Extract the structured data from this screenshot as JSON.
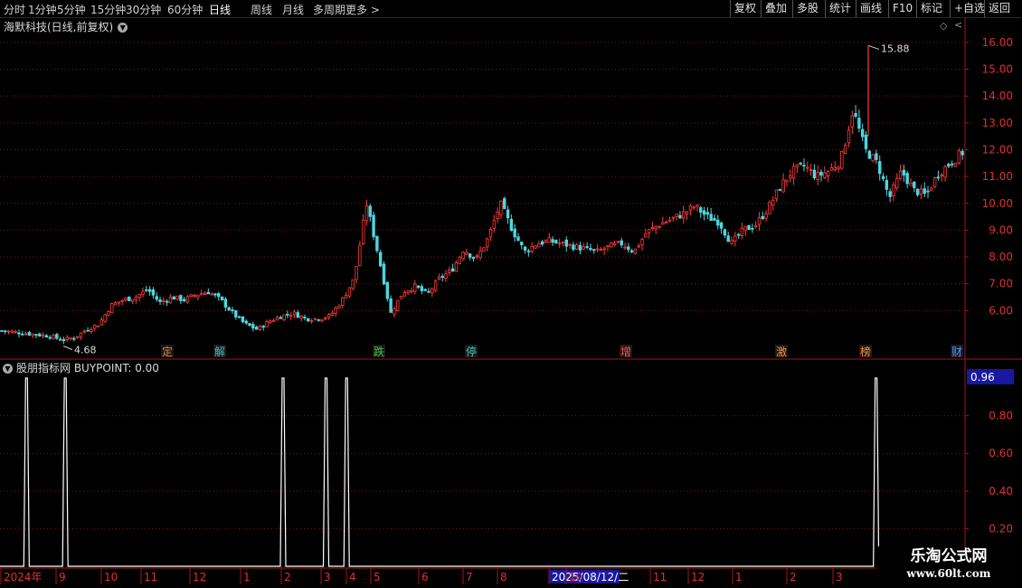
{
  "toolbar": {
    "periods": [
      "分时",
      "1分钟",
      "5分钟",
      "15分钟",
      "30分钟",
      "60分钟",
      "日线",
      "周线",
      "月线",
      "多周期",
      "更多 >"
    ],
    "active_period": "日线",
    "right_buttons": [
      "复权",
      "叠加",
      "多股",
      "统计",
      "画线",
      "F10",
      "标记",
      "+自选",
      "返回"
    ]
  },
  "stock": {
    "title": "海默科技(日线,前复权)"
  },
  "indicator": {
    "title": "股朋指标网  BUYPOINT: 0.00"
  },
  "watermark": {
    "title": "乐淘公式网",
    "url": "www.60lt.com"
  },
  "colors": {
    "up": "#ff3b3b",
    "down": "#4fd6e0",
    "grid": "#7a1a1a",
    "axis_text": "#e03030",
    "indicator_line": "#ffffff"
  },
  "chart_data": [
    {
      "type": "candlestick",
      "title": "海默科技(日线,前复权)",
      "y_ticks": [
        "6.00",
        "7.00",
        "8.00",
        "9.00",
        "10.00",
        "11.00",
        "12.00",
        "13.00",
        "14.00",
        "15.00",
        "16.00"
      ],
      "ylim": [
        5.0,
        16.3
      ],
      "grid": true,
      "high_marker": {
        "value": 15.88,
        "label": "15.88"
      },
      "low_marker": {
        "value": 4.68,
        "label": "4.68"
      },
      "event_tags": [
        "定",
        "解",
        "跌",
        "停",
        "增",
        "激",
        "榜",
        "财"
      ],
      "x_ticks": [
        "2024年",
        "9",
        "10",
        "11",
        "12",
        "1",
        "2",
        "3",
        "4",
        "5",
        "6",
        "7",
        "8",
        "2025/08/12/二",
        "10",
        "11",
        "12",
        "1",
        "2",
        "3"
      ],
      "close_path": [
        5.25,
        5.2,
        5.15,
        5.1,
        5.05,
        4.9,
        5.0,
        5.3,
        5.5,
        6.2,
        6.4,
        6.5,
        6.8,
        6.3,
        6.5,
        6.4,
        6.6,
        6.7,
        6.4,
        5.9,
        5.5,
        5.3,
        5.6,
        5.8,
        5.9,
        5.7,
        5.7,
        5.8,
        6.4,
        7.2,
        10.0,
        8.0,
        5.9,
        6.7,
        6.9,
        6.6,
        7.2,
        7.5,
        8.3,
        7.9,
        8.7,
        10.0,
        9.0,
        8.2,
        8.5,
        8.6,
        8.5,
        8.4,
        8.3,
        8.2,
        8.4,
        8.5,
        8.2,
        8.9,
        9.2,
        9.4,
        9.6,
        9.9,
        9.5,
        9.3,
        8.5,
        9.0,
        9.2,
        9.8,
        10.6,
        11.2,
        11.4,
        11.0,
        11.2,
        11.6,
        13.5,
        12.0,
        11.5,
        10.2,
        11.2,
        10.5,
        10.3,
        11.1,
        11.5,
        11.9
      ]
    },
    {
      "type": "line",
      "title": "BUYPOINT",
      "y_ticks": [
        "0.20",
        "0.40",
        "0.60",
        "0.80"
      ],
      "ylim": [
        0.0,
        1.0
      ],
      "current_value_label": "0.96",
      "spikes": [
        {
          "date_position": 0.0275,
          "value": 1.0
        },
        {
          "date_position": 0.0677,
          "value": 1.0
        },
        {
          "date_position": 0.2936,
          "value": 1.0
        },
        {
          "date_position": 0.3382,
          "value": 1.0
        },
        {
          "date_position": 0.3595,
          "value": 1.0
        },
        {
          "date_position": 0.9087,
          "value": 1.0
        }
      ]
    }
  ]
}
